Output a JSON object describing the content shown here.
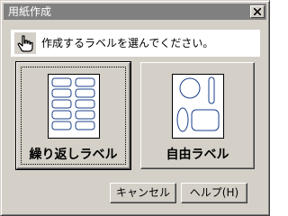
{
  "window": {
    "title": "用紙作成"
  },
  "instruction": {
    "text": "作成するラベルを選んでください。"
  },
  "choices": [
    {
      "label": "繰り返しラベル",
      "selected": true
    },
    {
      "label": "自由ラベル",
      "selected": false
    }
  ],
  "buttons": {
    "cancel_label": "キャンセル",
    "help_label": "ヘルプ(H)"
  },
  "icons": {
    "close": "close-icon",
    "hand": "pointing-hand-icon",
    "repeat_label_paper": "grid-labels-icon",
    "free_label_paper": "free-shapes-icon"
  },
  "colors": {
    "titlebar_inactive": "#808080",
    "dialog_face": "#d4d0c8",
    "label_fill": "#ffffff",
    "label_stroke": "#1a3f8a"
  }
}
